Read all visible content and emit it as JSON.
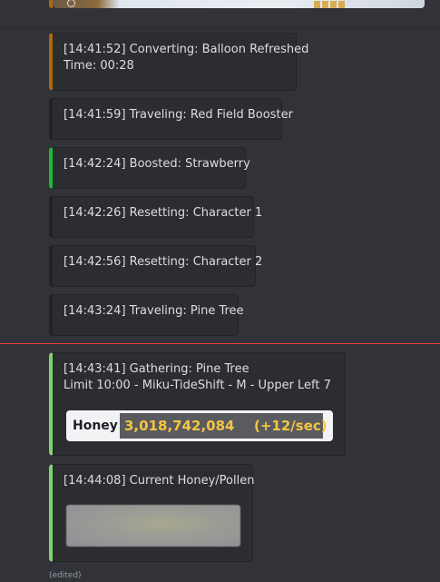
{
  "colors": {
    "background": "#313338",
    "embed_bg": "#2b2d31",
    "accent_orange": "#a86b10",
    "accent_dark": "#202225",
    "accent_green": "#1db83a",
    "accent_light_green": "#7fd36f",
    "new_messages_line": "#f23f43",
    "honey_value": "#f5c543"
  },
  "messages": [
    {
      "lines": [
        "[14:41:52] Converting: Balloon Refreshed",
        "Time: 00:28"
      ],
      "accent": "#a86b10"
    },
    {
      "lines": [
        "[14:41:59] Traveling: Red Field Booster"
      ],
      "accent": "#202225"
    },
    {
      "lines": [
        "[14:42:24] Boosted: Strawberry"
      ],
      "accent": "#1db83a"
    },
    {
      "lines": [
        "[14:42:26] Resetting: Character 1"
      ],
      "accent": "#202225"
    },
    {
      "lines": [
        "[14:42:56] Resetting: Character 2"
      ],
      "accent": "#202225"
    },
    {
      "lines": [
        "[14:43:24] Traveling: Pine Tree"
      ],
      "accent": "#202225"
    },
    {
      "lines": [
        "[14:43:41] Gathering: Pine Tree",
        "Limit 10:00 - Miku-TideShift - M - Upper Left 7"
      ],
      "accent": "#7fd36f"
    },
    {
      "lines": [
        "[14:44:08] Current Honey/Pollen"
      ],
      "accent": "#7fd36f"
    }
  ],
  "honey": {
    "label": "Honey",
    "value": "3,018,742,084",
    "rate": "(+12/sec)"
  },
  "footer": {
    "edited": "(edited)"
  }
}
